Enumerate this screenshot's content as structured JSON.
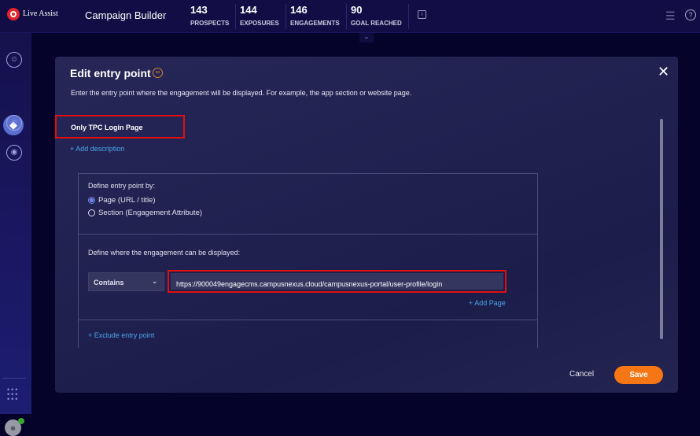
{
  "header": {
    "logo_text": "Live Assist",
    "title": "Campaign Builder",
    "stats": [
      {
        "value": "143",
        "label": "PROSPECTS"
      },
      {
        "value": "144",
        "label": "EXPOSURES"
      },
      {
        "value": "146",
        "label": "ENGAGEMENTS"
      },
      {
        "value": "90",
        "label": "GOAL REACHED"
      }
    ]
  },
  "sidebar": {
    "items": [
      {
        "icon": "agent-icon"
      },
      {
        "icon": "tag-icon",
        "active": true
      },
      {
        "icon": "user-icon"
      },
      {
        "icon": "bot-icon"
      }
    ]
  },
  "modal": {
    "title": "Edit entry point",
    "description": "Enter the entry point where the engagement will be displayed. For example, the app section or website page.",
    "name": "Only TPC Login Page",
    "add_description": "+ Add description",
    "define_by_label": "Define entry point by:",
    "options": [
      "Page (URL / title)",
      "Section (Engagement Attribute)"
    ],
    "selected_option": "Page (URL / title)",
    "where_label": "Define where the engagement can be displayed:",
    "match_type": "Contains",
    "url": "https://900049engagecms.campusnexus.cloud/campusnexus-portal/user-profile/login",
    "add_page": "+ Add Page",
    "exclude": "+ Exclude entry point",
    "cancel": "Cancel",
    "save": "Save"
  },
  "colors": {
    "accent": "#f57614",
    "link": "#4aa6e8",
    "highlight": "#e01010"
  }
}
